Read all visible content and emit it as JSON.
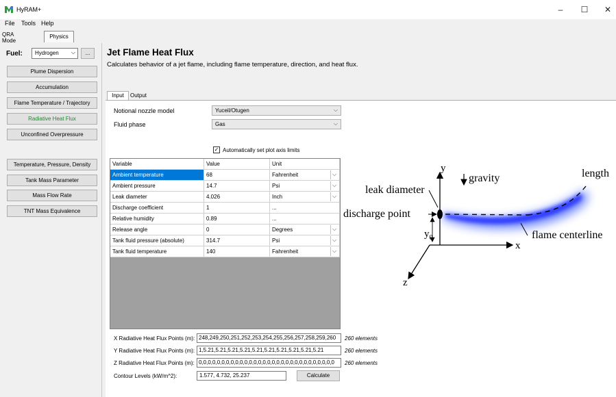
{
  "window": {
    "title": "HyRAM+",
    "minimize": "–",
    "maximize": "☐",
    "close": "✕"
  },
  "menu": [
    "File",
    "Tools",
    "Help"
  ],
  "modes": {
    "qra": "QRA Mode",
    "physics": "Physics"
  },
  "fuel": {
    "label": "Fuel:",
    "value": "Hydrogen",
    "more": "..."
  },
  "nav": [
    "Plume Dispersion",
    "Accumulation",
    "Flame Temperature / Trajectory",
    "Radiative Heat Flux",
    "Unconfined Overpressure",
    "Temperature, Pressure, Density",
    "Tank Mass Parameter",
    "Mass Flow Rate",
    "TNT Mass Equivalence"
  ],
  "page": {
    "title": "Jet Flame Heat Flux",
    "description": "Calculates behavior of a jet flame, including flame temperature, direction, and heat flux."
  },
  "tabs": {
    "input": "Input",
    "output": "Output"
  },
  "form": {
    "nozzle_label": "Notional nozzle model",
    "nozzle_value": "Yuceil/Otugen",
    "phase_label": "Fluid phase",
    "phase_value": "Gas",
    "autoscale_label": "Automatically set plot axis limits",
    "autoscale_checked": true
  },
  "grid": {
    "headers": [
      "Variable",
      "Value",
      "Unit"
    ],
    "rows": [
      {
        "variable": "Ambient temperature",
        "value": "68",
        "unit": "Fahrenheit"
      },
      {
        "variable": "Ambient pressure",
        "value": "14.7",
        "unit": "Psi"
      },
      {
        "variable": "Leak diameter",
        "value": "4.026",
        "unit": "Inch"
      },
      {
        "variable": "Discharge coefficient",
        "value": "1",
        "unit": "..."
      },
      {
        "variable": "Relative humidity",
        "value": "0.89",
        "unit": "..."
      },
      {
        "variable": "Release angle",
        "value": "0",
        "unit": "Degrees"
      },
      {
        "variable": "Tank fluid pressure (absolute)",
        "value": "314.7",
        "unit": "Psi"
      },
      {
        "variable": "Tank fluid temperature",
        "value": "140",
        "unit": "Fahrenheit"
      }
    ]
  },
  "points": {
    "x_label": "X Radiative Heat Flux Points (m):",
    "x_value": "248,249,250,251,252,253,254,255,256,257,258,259,260",
    "x_count": "260 elements",
    "y_label": "Y Radiative Heat Flux Points (m):",
    "y_value": "1,5.21,5.21,5.21,5.21,5.21,5.21,5.21,5.21,5.21,5.21",
    "y_count": "260 elements",
    "z_label": "Z Radiative Heat Flux Points (m):",
    "z_value": "0,0,0,0,0,0,0,0,0,0,0,0,0,0,0,0,0,0,0,0,0,0,0,0,0,0,0,0,0,0",
    "z_count": "260 elements",
    "contour_label": "Contour Levels (kW/m^2):",
    "contour_value": "1.577, 4.732, 25.237",
    "calculate": "Calculate"
  },
  "diagram": {
    "y": "y",
    "x": "x",
    "z": "z",
    "gravity": "gravity",
    "length": "length",
    "leak_diameter": "leak diameter",
    "discharge_point": "discharge point",
    "flame_centerline": "flame centerline",
    "y0": "y",
    "y0_sub": "0"
  }
}
